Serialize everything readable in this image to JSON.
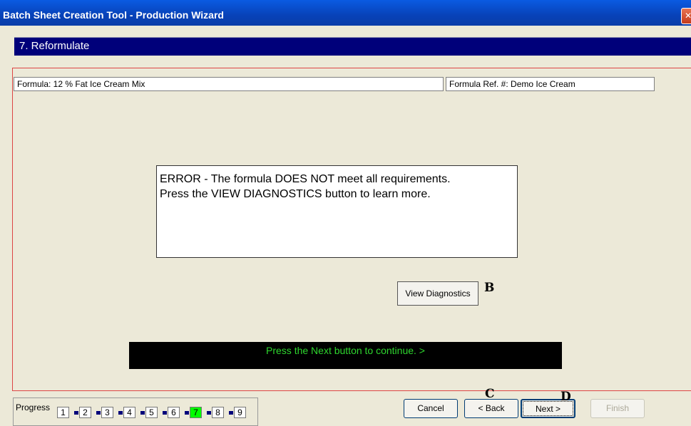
{
  "window": {
    "title": "Batch Sheet Creation Tool - Production Wizard",
    "close_glyph": "✕"
  },
  "step": {
    "title": "7. Reformulate"
  },
  "formula": {
    "name": "Formula: 12 % Fat Ice Cream Mix",
    "ref": "Formula Ref. #:  Demo Ice Cream"
  },
  "error": {
    "line1": "ERROR - The formula DOES NOT meet all requirements.",
    "line2": " Press the VIEW DIAGNOSTICS button to learn more."
  },
  "buttons": {
    "view_diagnostics": "View Diagnostics",
    "cancel": "Cancel",
    "back": "< Back",
    "next": "Next >",
    "finish": "Finish"
  },
  "message": "Press the Next button to continue. >",
  "annotations": {
    "b": "B",
    "c": "C",
    "d": "D"
  },
  "progress": {
    "label": "Progress",
    "steps": [
      "1",
      "2",
      "3",
      "4",
      "5",
      "6",
      "7",
      "8",
      "9"
    ],
    "active_step": "7",
    "active_color": "#00ff00"
  },
  "colors": {
    "title_bar": "#0842b8",
    "step_bar": "#00007a",
    "message_text": "#2ed62e"
  }
}
